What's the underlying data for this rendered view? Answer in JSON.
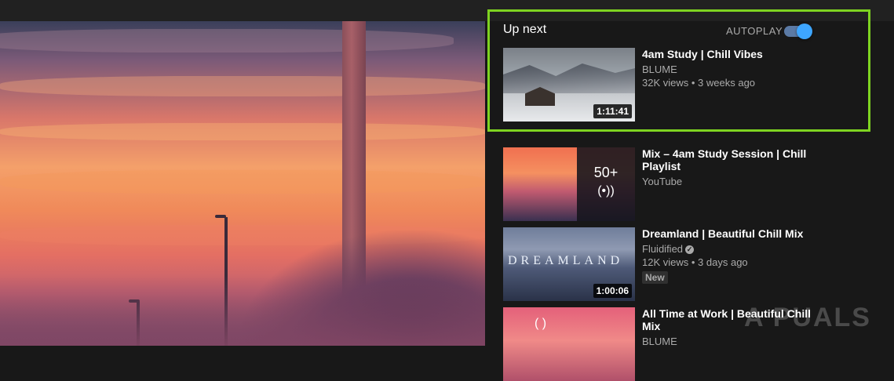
{
  "up_next": {
    "title": "Up next",
    "autoplay_label": "AUTOPLAY",
    "autoplay_on": true,
    "accent_color": "#3ea6ff",
    "highlight_color": "#7ed321"
  },
  "videos": [
    {
      "title": "4am Study | Chill Vibes",
      "channel": "BLUME",
      "views": "32K views",
      "age": "3 weeks ago",
      "duration": "1:11:41"
    },
    {
      "title": "Mix – 4am Study Session | Chill Playlist",
      "channel": "YouTube",
      "playlist_count": "50+",
      "playlist_icon": "(•))"
    },
    {
      "title": "Dreamland | Beautiful Chill Mix",
      "channel": "Fluidified",
      "verified": true,
      "views": "12K views",
      "age": "3 days ago",
      "badge": "New",
      "duration": "1:00:06",
      "thumb_text": "DREAMLAND"
    },
    {
      "title": "All Time at Work | Beautiful Chill Mix",
      "channel": "BLUME",
      "thumb_text": "( )"
    }
  ],
  "watermark": "A PUALS"
}
